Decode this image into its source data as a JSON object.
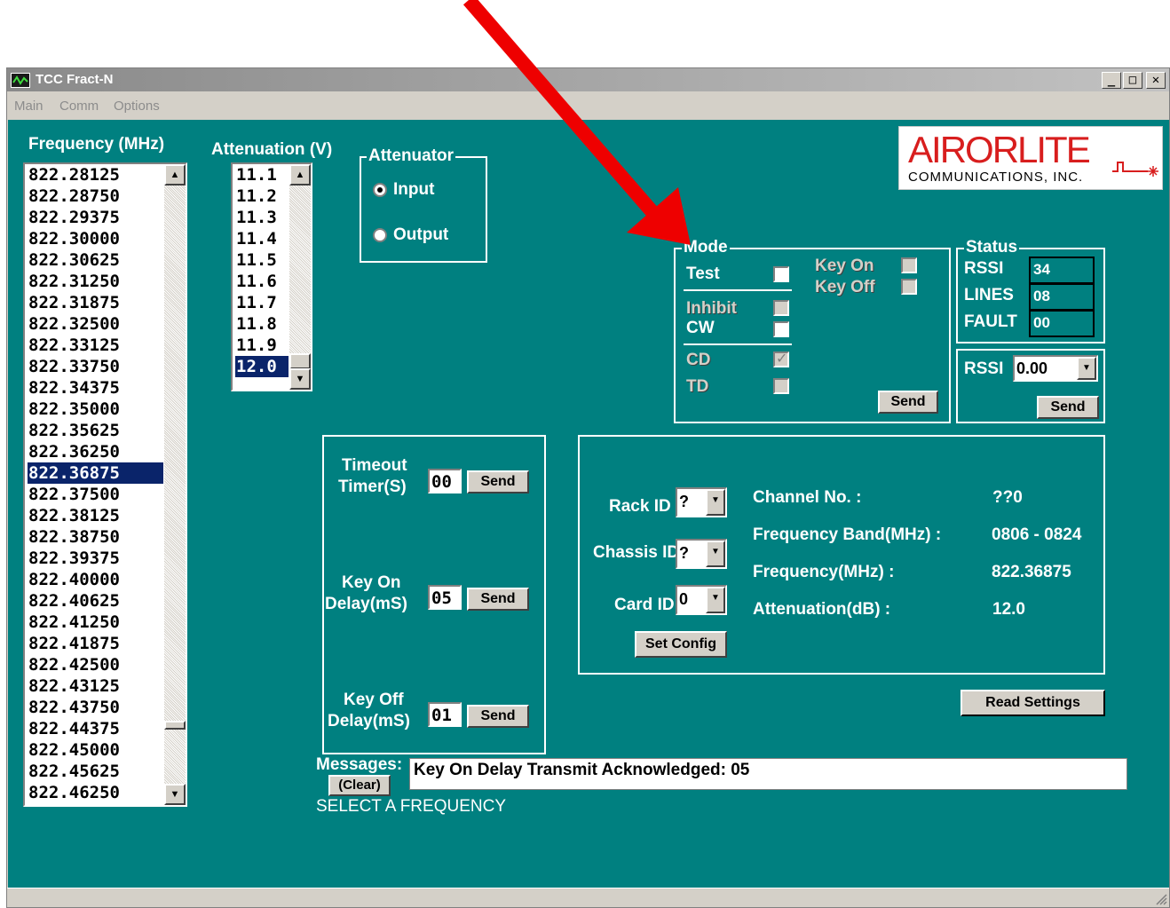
{
  "window": {
    "title": "TCC Fract-N"
  },
  "menu": {
    "items": [
      "Main",
      "Comm",
      "Options"
    ]
  },
  "frequency": {
    "label": "Frequency (MHz)",
    "items": [
      "822.28125",
      "822.28750",
      "822.29375",
      "822.30000",
      "822.30625",
      "822.31250",
      "822.31875",
      "822.32500",
      "822.33125",
      "822.33750",
      "822.34375",
      "822.35000",
      "822.35625",
      "822.36250",
      "822.36875",
      "822.37500",
      "822.38125",
      "822.38750",
      "822.39375",
      "822.40000",
      "822.40625",
      "822.41250",
      "822.41875",
      "822.42500",
      "822.43125",
      "822.43750",
      "822.44375",
      "822.45000",
      "822.45625",
      "822.46250"
    ],
    "selected": "822.36875"
  },
  "attenuation": {
    "label": "Attenuation (V)",
    "items": [
      "11.1",
      "11.2",
      "11.3",
      "11.4",
      "11.5",
      "11.6",
      "11.7",
      "11.8",
      "11.9",
      "12.0"
    ],
    "selected": "12.0"
  },
  "attenuator": {
    "title": "Attenuator",
    "input_label": "Input",
    "output_label": "Output",
    "selected": "Input"
  },
  "logo": {
    "name_red_a": "AI",
    "name_red_b": "R",
    "name_mid": "OR",
    "name_end": "LITE",
    "subtitle": "COMMUNICATIONS, INC."
  },
  "mode": {
    "title": "Mode",
    "test": "Test",
    "inhibit": "Inhibit",
    "cw": "CW",
    "cd": "CD",
    "td": "TD",
    "key_on": "Key On",
    "key_off": "Key Off",
    "send": "Send"
  },
  "status": {
    "title": "Status",
    "rssi_label": "RSSI",
    "rssi_value": "34",
    "lines_label": "LINES",
    "lines_value": "08",
    "fault_label": "FAULT",
    "fault_value": "00"
  },
  "rssi_select": {
    "label": "RSSI",
    "value": "0.00",
    "send": "Send"
  },
  "timers": {
    "timeout_l1": "Timeout",
    "timeout_l2": "Timer(S)",
    "timeout_value": "00",
    "keyon_l1": "Key On",
    "keyon_l2": "Delay(mS)",
    "keyon_value": "05",
    "keyoff_l1": "Key Off",
    "keyoff_l2": "Delay(mS)",
    "keyoff_value": "01",
    "send": "Send"
  },
  "config": {
    "rack_label": "Rack ID",
    "rack_value": "?",
    "chassis_label": "Chassis ID",
    "chassis_value": "?",
    "card_label": "Card ID",
    "card_value": "0",
    "set_config": "Set Config",
    "channel_label": "Channel No. :",
    "channel_value": "??0",
    "band_label": "Frequency Band(MHz) :",
    "band_value": "0806 - 0824",
    "freq_label": "Frequency(MHz) :",
    "freq_value": "822.36875",
    "atten_label": "Attenuation(dB) :",
    "atten_value": "12.0"
  },
  "read_settings": "Read Settings",
  "messages": {
    "label": "Messages:",
    "clear": "(Clear)",
    "text": "Key On Delay Transmit Acknowledged: 05",
    "hint": "SELECT A FREQUENCY"
  },
  "colors": {
    "client_bg": "#008080",
    "arrow": "#ee0000",
    "selection": "#0a246a"
  }
}
